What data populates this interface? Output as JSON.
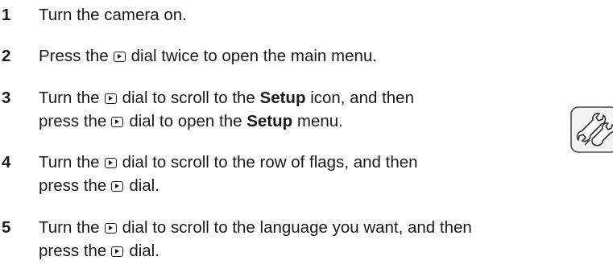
{
  "steps": [
    {
      "number": "1",
      "text": "Turn the camera on."
    },
    {
      "number": "2",
      "pre": "Press the",
      "post": "dial twice to open the main menu."
    },
    {
      "number": "3",
      "line1_pre": "Turn the",
      "line1_mid": "dial to scroll to the",
      "line1_bold": "Setup",
      "line1_post": "icon, and then",
      "line2_pre": "press the",
      "line2_mid": "dial to open the",
      "line2_bold": "Setup",
      "line2_post": "menu."
    },
    {
      "number": "4",
      "line1_pre": "Turn the",
      "line1_post": "dial to scroll to the row of flags, and then",
      "line2_pre": "press the",
      "line2_post": "dial."
    },
    {
      "number": "5",
      "line1_pre": "Turn the",
      "line1_post": "dial to scroll to the language you want, and then",
      "line2_pre": "press the",
      "line2_post": "dial."
    }
  ],
  "icons": {
    "dial": "playback-dial-icon",
    "setup": "setup-wrench-icon"
  }
}
